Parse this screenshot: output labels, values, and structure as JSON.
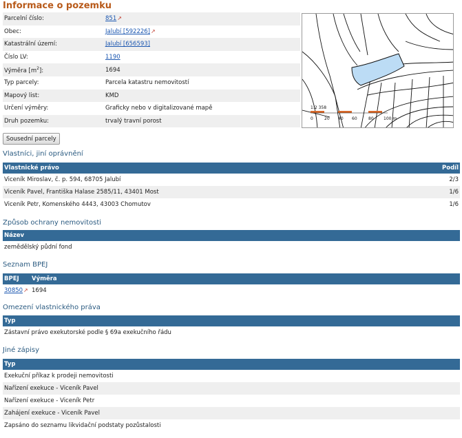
{
  "title": "Informace o pozemku",
  "info": {
    "rows": [
      {
        "label": "Parcelní číslo:",
        "value": "851",
        "link": true,
        "ext": true
      },
      {
        "label": "Obec:",
        "value": "Jalubí [592226]",
        "link": true,
        "ext": true
      },
      {
        "label": "Katastrální území:",
        "value": "Jalubí [656593]",
        "link": true,
        "ext": false
      },
      {
        "label": "Číslo LV:",
        "value": "1190",
        "link": true,
        "ext": false
      },
      {
        "label": "Výměra [m2]:",
        "value": "1694",
        "link": false,
        "ext": false
      },
      {
        "label": "Typ parcely:",
        "value": "Parcela katastru nemovitostí",
        "link": false,
        "ext": false
      },
      {
        "label": "Mapový list:",
        "value": "KMD",
        "link": false,
        "ext": false
      },
      {
        "label": "Určení výměry:",
        "value": "Graficky nebo v digitalizované mapě",
        "link": false,
        "ext": false
      },
      {
        "label": "Druh pozemku:",
        "value": "trvalý travní porost",
        "link": false,
        "ext": false
      }
    ]
  },
  "map": {
    "scale_ratio": "1:2 358",
    "scale_labels": [
      "0",
      "20",
      "40",
      "60",
      "80",
      "100 m"
    ],
    "parcel_color": "#bcdcf5"
  },
  "neighbors_button": "Sousední parcely",
  "owners": {
    "heading": "Vlastníci, jiní oprávnění",
    "columns": [
      "Vlastnické právo",
      "Podíl"
    ],
    "rows": [
      [
        "Viceník Miroslav, č. p. 594, 68705 Jalubí",
        "2/3"
      ],
      [
        "Viceník Pavel, Františka Halase 2585/11, 43401 Most",
        "1/6"
      ],
      [
        "Viceník Petr, Komenského 4443, 43003 Chomutov",
        "1/6"
      ]
    ]
  },
  "protection": {
    "heading": "Způsob ochrany nemovitosti",
    "columns": [
      "Název"
    ],
    "rows": [
      [
        "zemědělský půdní fond"
      ]
    ]
  },
  "bpej": {
    "heading": "Seznam BPEJ",
    "columns": [
      "BPEJ",
      "Výměra"
    ],
    "rows": [
      [
        "30850",
        "1694"
      ]
    ]
  },
  "restrictions": {
    "heading": "Omezení vlastnického práva",
    "columns": [
      "Typ"
    ],
    "rows": [
      [
        "Zástavní právo exekutorské podle § 69a exekučního řádu"
      ]
    ]
  },
  "other": {
    "heading": "Jiné zápisy",
    "columns": [
      "Typ"
    ],
    "rows": [
      [
        "Exekuční příkaz k prodeji nemovitosti"
      ],
      [
        "Nařízení exekuce - Viceník Pavel"
      ],
      [
        "Nařízení exekuce - Viceník Petr"
      ],
      [
        "Zahájení exekuce - Viceník Pavel"
      ],
      [
        "Zapsáno do seznamu likvidační podstaty pozůstalosti"
      ]
    ]
  }
}
